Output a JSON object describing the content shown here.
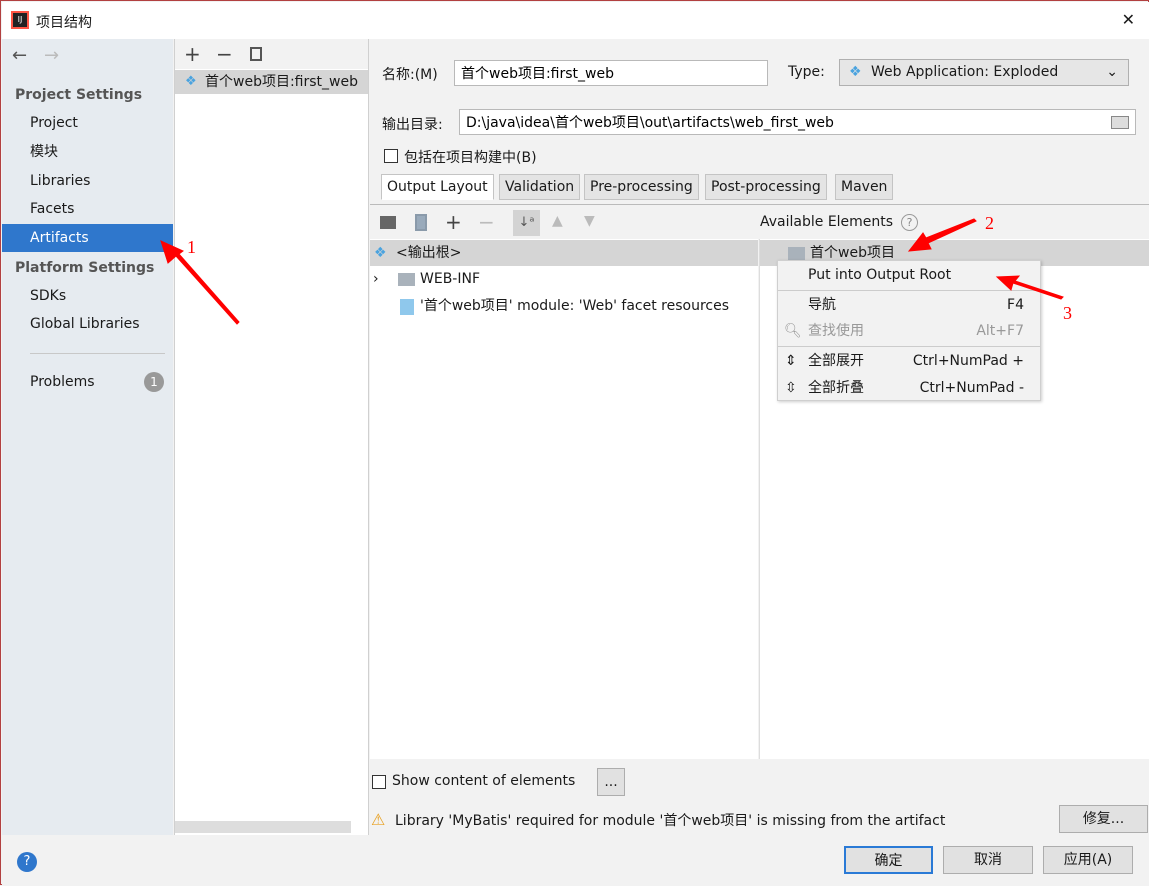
{
  "window": {
    "title": "项目结构",
    "close": "✕"
  },
  "nav": {
    "back": "←",
    "forward": "→"
  },
  "sidebar": {
    "project_settings": "Project Settings",
    "items": [
      {
        "label": "Project"
      },
      {
        "label": "模块"
      },
      {
        "label": "Libraries"
      },
      {
        "label": "Facets"
      },
      {
        "label": "Artifacts",
        "selected": true
      }
    ],
    "platform_settings": "Platform Settings",
    "platform_items": [
      {
        "label": "SDKs"
      },
      {
        "label": "Global Libraries"
      }
    ],
    "problems": {
      "label": "Problems",
      "count": "1"
    }
  },
  "artifact_list": {
    "add": "+",
    "remove": "−",
    "items": [
      "首个web项目:first_web"
    ]
  },
  "form": {
    "name_label": "名称:(M)",
    "name_value": "首个web项目:first_web",
    "type_label": "Type:",
    "type_value": "Web Application: Exploded",
    "output_label": "输出目录:",
    "output_value": "D:\\java\\idea\\首个web项目\\out\\artifacts\\web_first_web",
    "include_label": "包括在项目构建中(B)",
    "include_checked": false
  },
  "tabs": [
    {
      "label": "Output Layout",
      "selected": true
    },
    {
      "label": "Validation"
    },
    {
      "label": "Pre-processing"
    },
    {
      "label": "Post-processing"
    },
    {
      "label": "Maven"
    }
  ],
  "layout_tree": {
    "root": "<输出根>",
    "items": [
      "WEB-INF",
      "'首个web项目' module: 'Web' facet resources"
    ]
  },
  "available": {
    "title": "Available Elements",
    "help": "?",
    "items": [
      "首个web项目"
    ]
  },
  "context_menu": {
    "items": [
      {
        "label": "Put into Output Root",
        "shortcut": ""
      },
      {
        "label": "导航",
        "shortcut": "F4"
      },
      {
        "label": "查找使用",
        "shortcut": "Alt+F7",
        "disabled": true
      },
      {
        "label": "全部展开",
        "shortcut": "Ctrl+NumPad +"
      },
      {
        "label": "全部折叠",
        "shortcut": "Ctrl+NumPad -"
      }
    ]
  },
  "bottom": {
    "show_content_label": "Show content of elements",
    "show_content_checked": false,
    "more": "...",
    "warning": "Library 'MyBatis' required for module '首个web项目' is missing from the artifact",
    "fix": "修复..."
  },
  "footer": {
    "help": "?",
    "ok": "确定",
    "cancel": "取消",
    "apply": "应用(A)"
  },
  "annotations": {
    "n1": "1",
    "n2": "2",
    "n3": "3",
    "color": "#ff0000"
  }
}
